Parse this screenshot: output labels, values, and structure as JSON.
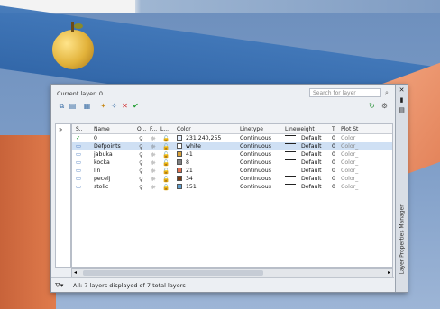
{
  "palette": {
    "current_layer": "Current layer: 0",
    "search_placeholder": "Search for layer",
    "vertical_title": "Layer Properties Manager",
    "status": "All: 7 layers displayed of 7 total layers"
  },
  "headers": [
    "S..",
    "Name",
    "O...",
    "F...",
    "L...",
    "Color",
    "Linetype",
    "Lineweight",
    "T",
    "Plot St"
  ],
  "layers": [
    {
      "status": "✓",
      "name": "0",
      "color_label": "231,240,255",
      "color_hex": "#e7f0ff",
      "linetype": "Continuous",
      "lineweight": "Default",
      "t": "0",
      "plot": "Color_"
    },
    {
      "status": "▭",
      "name": "Defpoints",
      "color_label": "white",
      "color_hex": "#ffffff",
      "linetype": "Continuous",
      "lineweight": "Default",
      "t": "0",
      "plot": "Color_"
    },
    {
      "status": "▭",
      "name": "jabuka",
      "color_label": "41",
      "color_hex": "#d9a23a",
      "linetype": "Continuous",
      "lineweight": "Default",
      "t": "0",
      "plot": "Color_"
    },
    {
      "status": "▭",
      "name": "kocka",
      "color_label": "8",
      "color_hex": "#808080",
      "linetype": "Continuous",
      "lineweight": "Default",
      "t": "0",
      "plot": "Color_"
    },
    {
      "status": "▭",
      "name": "lin",
      "color_label": "21",
      "color_hex": "#e07050",
      "linetype": "Continuous",
      "lineweight": "Default",
      "t": "0",
      "plot": "Color_"
    },
    {
      "status": "▭",
      "name": "pecelj",
      "color_label": "34",
      "color_hex": "#7a3a10",
      "linetype": "Continuous",
      "lineweight": "Default",
      "t": "0",
      "plot": "Color_"
    },
    {
      "status": "▭",
      "name": "stolic",
      "color_label": "151",
      "color_hex": "#5f9fd0",
      "linetype": "Continuous",
      "lineweight": "Default",
      "t": "0",
      "plot": "Color_"
    }
  ],
  "icons": {
    "toolbar": [
      "new-property-filter-icon",
      "new-group-filter-icon",
      "layer-states-manager-icon",
      "new-layer-icon",
      "new-layer-vp-frozen-icon",
      "delete-layer-icon",
      "set-current-icon"
    ],
    "right": [
      "refresh-icon",
      "settings-icon"
    ]
  }
}
